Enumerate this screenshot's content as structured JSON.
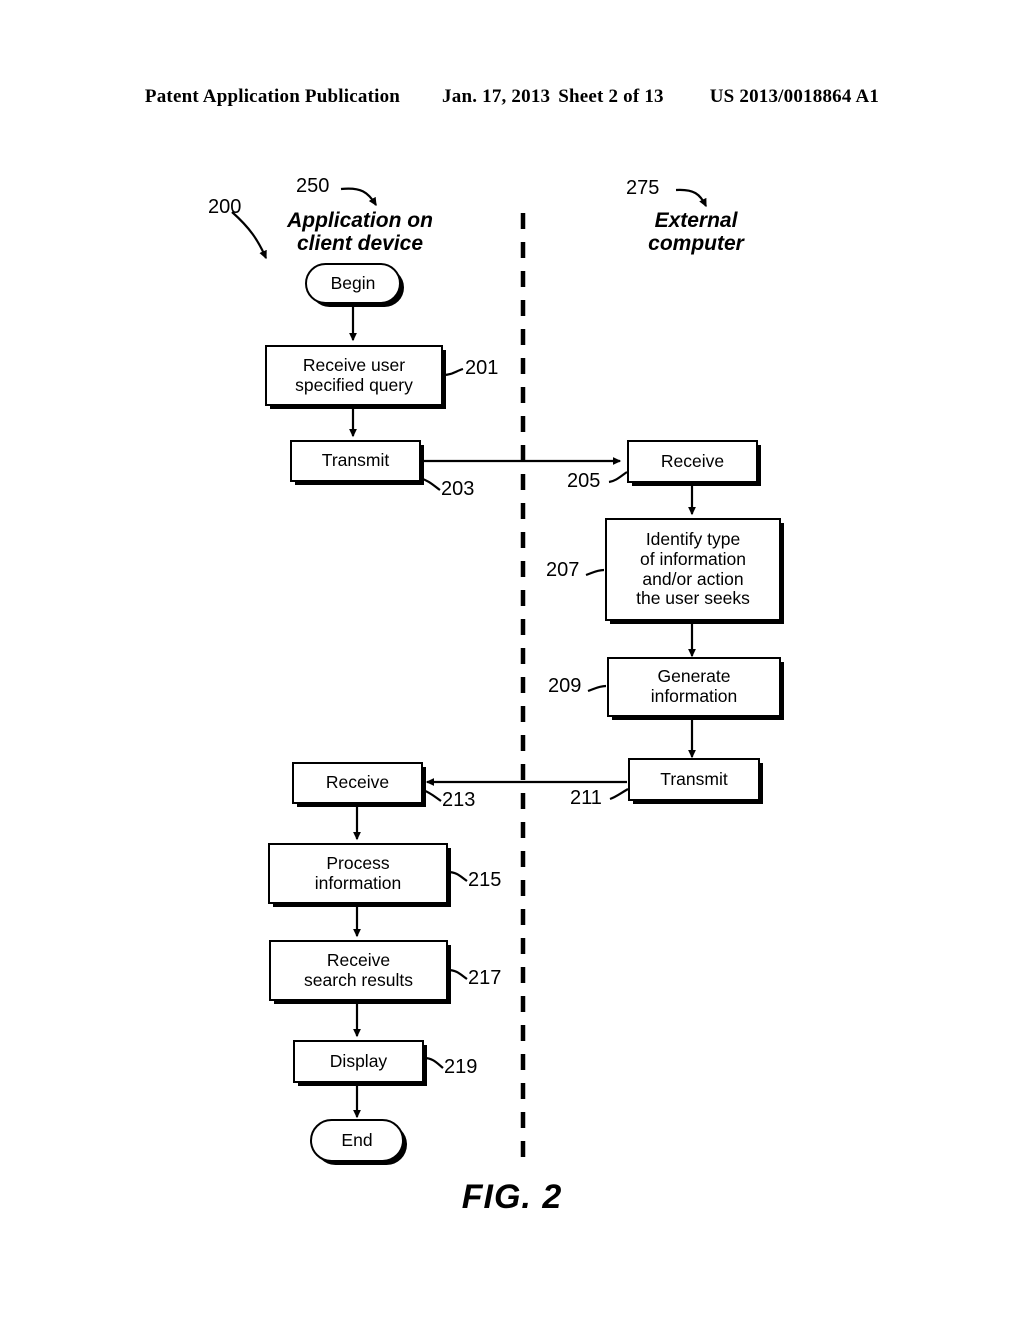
{
  "header": {
    "publication": "Patent Application Publication",
    "date": "Jan. 17, 2013",
    "sheet": "Sheet 2 of 13",
    "document_number": "US 2013/0018864 A1"
  },
  "figure": {
    "caption": "FIG. 2",
    "diagram_ref": "200"
  },
  "columns": {
    "left": {
      "ref": "250",
      "title": "Application on\nclient device"
    },
    "right": {
      "ref": "275",
      "title": "External\ncomputer"
    }
  },
  "nodes": {
    "begin": {
      "label": "Begin",
      "ref": ""
    },
    "n201": {
      "label": "Receive user\nspecified query",
      "ref": "201"
    },
    "n203": {
      "label": "Transmit",
      "ref": "203"
    },
    "n205": {
      "label": "Receive",
      "ref": "205"
    },
    "n207": {
      "label": "Identify type\nof information\nand/or action\nthe user seeks",
      "ref": "207"
    },
    "n209": {
      "label": "Generate\ninformation",
      "ref": "209"
    },
    "n211": {
      "label": "Transmit",
      "ref": "211"
    },
    "n213": {
      "label": "Receive",
      "ref": "213"
    },
    "n215": {
      "label": "Process\ninformation",
      "ref": "215"
    },
    "n217": {
      "label": "Receive\nsearch results",
      "ref": "217"
    },
    "n219": {
      "label": "Display",
      "ref": "219"
    },
    "end": {
      "label": "End",
      "ref": ""
    }
  },
  "colors": {
    "ink": "#000000",
    "paper": "#ffffff"
  }
}
